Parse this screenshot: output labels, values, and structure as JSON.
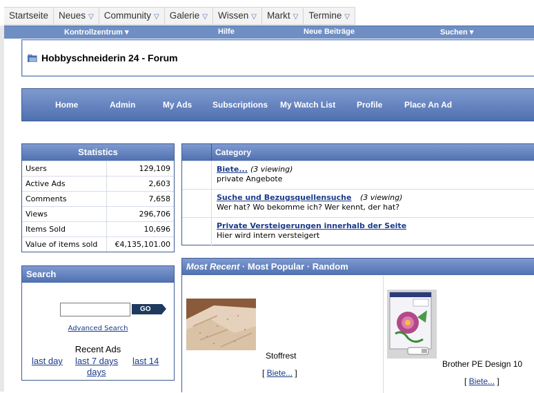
{
  "top_menu": {
    "items": [
      {
        "label": "Startseite",
        "dropdown": false
      },
      {
        "label": "Neues",
        "dropdown": true
      },
      {
        "label": "Community",
        "dropdown": true
      },
      {
        "label": "Galerie",
        "dropdown": true
      },
      {
        "label": "Wissen",
        "dropdown": true
      },
      {
        "label": "Markt",
        "dropdown": true
      },
      {
        "label": "Termine",
        "dropdown": true
      }
    ]
  },
  "nav": {
    "kontrollzentrum": "Kontrollzentrum",
    "hilfe": "Hilfe",
    "neue_beitraege": "Neue Beiträge",
    "suchen": "Suchen"
  },
  "forum": {
    "title": "Hobbyschneiderin 24 - Forum"
  },
  "ad_nav": {
    "home": "Home",
    "admin": "Admin",
    "my_ads": "My Ads",
    "subscriptions": "Subscriptions",
    "watch_list": "My Watch List",
    "profile": "Profile",
    "place_ad": "Place An Ad"
  },
  "stats": {
    "title": "Statistics",
    "rows": [
      {
        "label": "Users",
        "value": "129,109"
      },
      {
        "label": "Active Ads",
        "value": "2,603"
      },
      {
        "label": "Comments",
        "value": "7,658"
      },
      {
        "label": "Views",
        "value": "296,706"
      },
      {
        "label": "Items Sold",
        "value": "10,696"
      },
      {
        "label": "Value of items sold",
        "value": "€4,135,101.00"
      }
    ]
  },
  "search": {
    "title": "Search",
    "input_value": "",
    "go_label": "GO",
    "advanced": "Advanced Search",
    "recent_ads": "Recent Ads",
    "last_day": "last day",
    "last_7_days": "last 7 days",
    "last_14_days_a": "last 14",
    "last_14_days_b": "days"
  },
  "categories": {
    "header": "Category",
    "items": [
      {
        "name": "Biete...",
        "viewing": "(3 viewing)",
        "description": "private Angebote"
      },
      {
        "name": "Suche und Bezugsquellensuche",
        "viewing": "(3 viewing)",
        "description": "Wer hat? Wo bekomme ich? Wer kennt, der hat?"
      },
      {
        "name": "Private Versteigerungen innerhalb der Seite",
        "viewing": "",
        "description": "Hier wird intern versteigert"
      }
    ]
  },
  "recent": {
    "tab_recent": "Most Recent",
    "tab_popular": "Most Popular",
    "tab_random": "Random",
    "separator": " · ",
    "ads": [
      {
        "name": "Stoffrest",
        "link_open": "[ ",
        "link": "Biete...",
        "link_close": " ]"
      },
      {
        "name": "Brother PE Design 10",
        "link_open": "[ ",
        "link": "Biete...",
        "link_close": " ]"
      }
    ]
  },
  "colors": {
    "header_blue_top": "#7f9ad0",
    "header_blue_bottom": "#4f70b0",
    "border_blue": "#3d5a92",
    "link_blue": "#1a3a8a"
  }
}
